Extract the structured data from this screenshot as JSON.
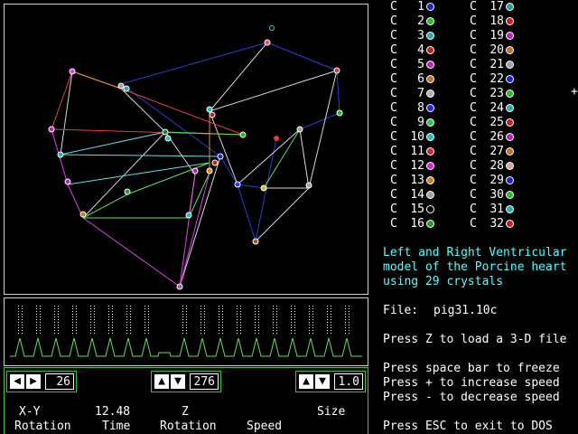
{
  "legend": {
    "prefix": "C",
    "items": [
      {
        "n": "1",
        "color": "#2020d0"
      },
      {
        "n": "2",
        "color": "#20c020"
      },
      {
        "n": "3",
        "color": "#20b0b0"
      },
      {
        "n": "4",
        "color": "#c02020"
      },
      {
        "n": "5",
        "color": "#c020c0"
      },
      {
        "n": "6",
        "color": "#c07020"
      },
      {
        "n": "7",
        "color": "#b0b0b0"
      },
      {
        "n": "8",
        "color": "#2020ff"
      },
      {
        "n": "9",
        "color": "#20d040"
      },
      {
        "n": "10",
        "color": "#20c0c0"
      },
      {
        "n": "11",
        "color": "#e02040"
      },
      {
        "n": "12",
        "color": "#e020e0"
      },
      {
        "n": "13",
        "color": "#d08020"
      },
      {
        "n": "14",
        "color": "#a0a0a0"
      },
      {
        "n": "15",
        "color": "#000000"
      },
      {
        "n": "16",
        "color": "#20a020"
      },
      {
        "n": "17",
        "color": "#20a0a0"
      },
      {
        "n": "18",
        "color": "#c02020"
      },
      {
        "n": "19",
        "color": "#c020c0"
      },
      {
        "n": "20",
        "color": "#c07020"
      },
      {
        "n": "21",
        "color": "#a0a0a0"
      },
      {
        "n": "22",
        "color": "#2020d0"
      },
      {
        "n": "23",
        "color": "#20c020"
      },
      {
        "n": "24",
        "color": "#20b0b0"
      },
      {
        "n": "25",
        "color": "#c02020"
      },
      {
        "n": "26",
        "color": "#c020c0"
      },
      {
        "n": "27",
        "color": "#c07020"
      },
      {
        "n": "28",
        "color": "#e0a0a0"
      },
      {
        "n": "29",
        "color": "#2020d0"
      },
      {
        "n": "30",
        "color": "#20c020"
      },
      {
        "n": "31",
        "color": "#20b0b0"
      },
      {
        "n": "32",
        "color": "#c02020"
      }
    ]
  },
  "description": {
    "line1": "Left and Right Ventricular",
    "line2": "model of the Porcine heart",
    "line3": "using 29 crystals"
  },
  "file": {
    "label": "File:",
    "name": "pig31.10c"
  },
  "instructions": {
    "load": "Press Z to load a 3-D file",
    "freeze": "Press space bar to freeze",
    "increase": "Press + to increase speed",
    "decrease": "Press - to decrease speed",
    "exit": "Press ESC to exit to DOS"
  },
  "controls": {
    "xy_value": "26",
    "time_value": "12.48",
    "z_value": "276",
    "size_value": "1.0",
    "xy_label1": "X-Y",
    "xy_label2": "Rotation",
    "time_label": "Time",
    "z_label1": "Z",
    "z_label2": "Rotation",
    "speed_label": "Speed",
    "size_label": "Size"
  },
  "cursor_marker": "+",
  "icons": {
    "left": "left-arrow-icon",
    "right": "right-arrow-icon",
    "up": "up-arrow-icon",
    "down": "down-arrow-icon"
  }
}
